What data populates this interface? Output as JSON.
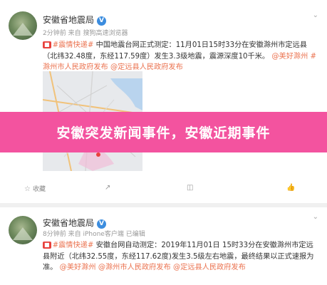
{
  "post1": {
    "author": "安徽省地震局",
    "meta": "2分钟前 来自 搜狗高速浏览器",
    "tag": "#震情快递#",
    "text_1": " 中国地震台网正式测定：11月01日15时33分在安徽滁州市定远县（北纬32.48度，东经117.59度）发生3.3级地震，震源深度10千米。",
    "link_1": "@美好滁州",
    "link_2": "#滁州市人民政府发布",
    "link_3": "@定远县人民政府发布",
    "actions": {
      "collect": "收藏",
      "share": "",
      "comment": "",
      "like": ""
    }
  },
  "banner": {
    "title": "安徽突发新闻事件，安徽近期事件"
  },
  "post2": {
    "author": "安徽省地震局",
    "meta": "8分钟前 来自 iPhone客户端 已编辑",
    "tag": "#震情快递#",
    "text_1": " 安徽台网自动测定：2019年11月01日 15时33分在安徽滁州市定远县附近（北纬32.55度，东经117.62度)发生3.5级左右地震，最终结果以正式速报为准。",
    "link_1": "@美好滁州",
    "link_2": "@滁州市人民政府发布",
    "link_3": "@定远县人民政府发布"
  },
  "icons": {
    "verified": "verified-badge-icon",
    "dropdown": "chevron-down-icon",
    "collect": "star-icon",
    "share": "share-icon",
    "comment": "comment-icon",
    "like": "thumb-up-icon"
  },
  "colors": {
    "banner": "#f3539f",
    "link": "#eb7350",
    "tag": "#e8413d",
    "verified": "#3c8ddf"
  }
}
